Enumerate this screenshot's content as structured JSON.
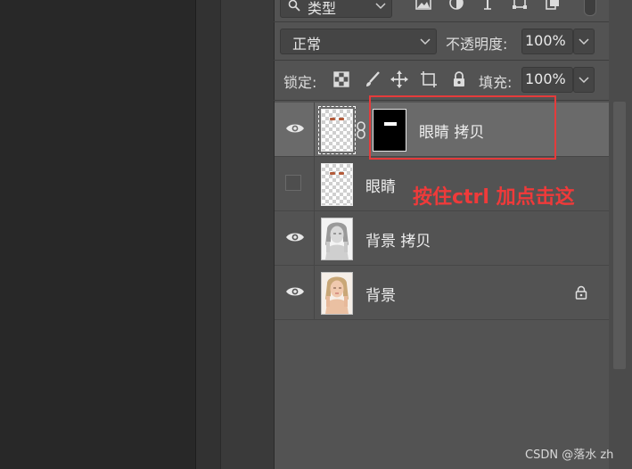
{
  "filter": {
    "type_label": "类型"
  },
  "blend": {
    "mode": "正常",
    "opacity_label": "不透明度:",
    "opacity_value": "100%"
  },
  "lock": {
    "label": "锁定:",
    "fill_label": "填充:",
    "fill_value": "100%"
  },
  "layers": [
    {
      "name": "眼睛 拷贝",
      "visible": true,
      "selected": true,
      "has_mask": true
    },
    {
      "name": "眼睛",
      "visible": false
    },
    {
      "name": "背景 拷贝",
      "visible": true
    },
    {
      "name": "背景",
      "visible": true,
      "locked": true
    }
  ],
  "annotation": {
    "text": "按住ctrl 加点击这",
    "color": "#e53b3b"
  },
  "watermark": "CSDN @落水 zh",
  "colors": {
    "panel_bg": "#535353",
    "selected_row": "#6a6a6a",
    "annotation": "#e53b3b"
  }
}
